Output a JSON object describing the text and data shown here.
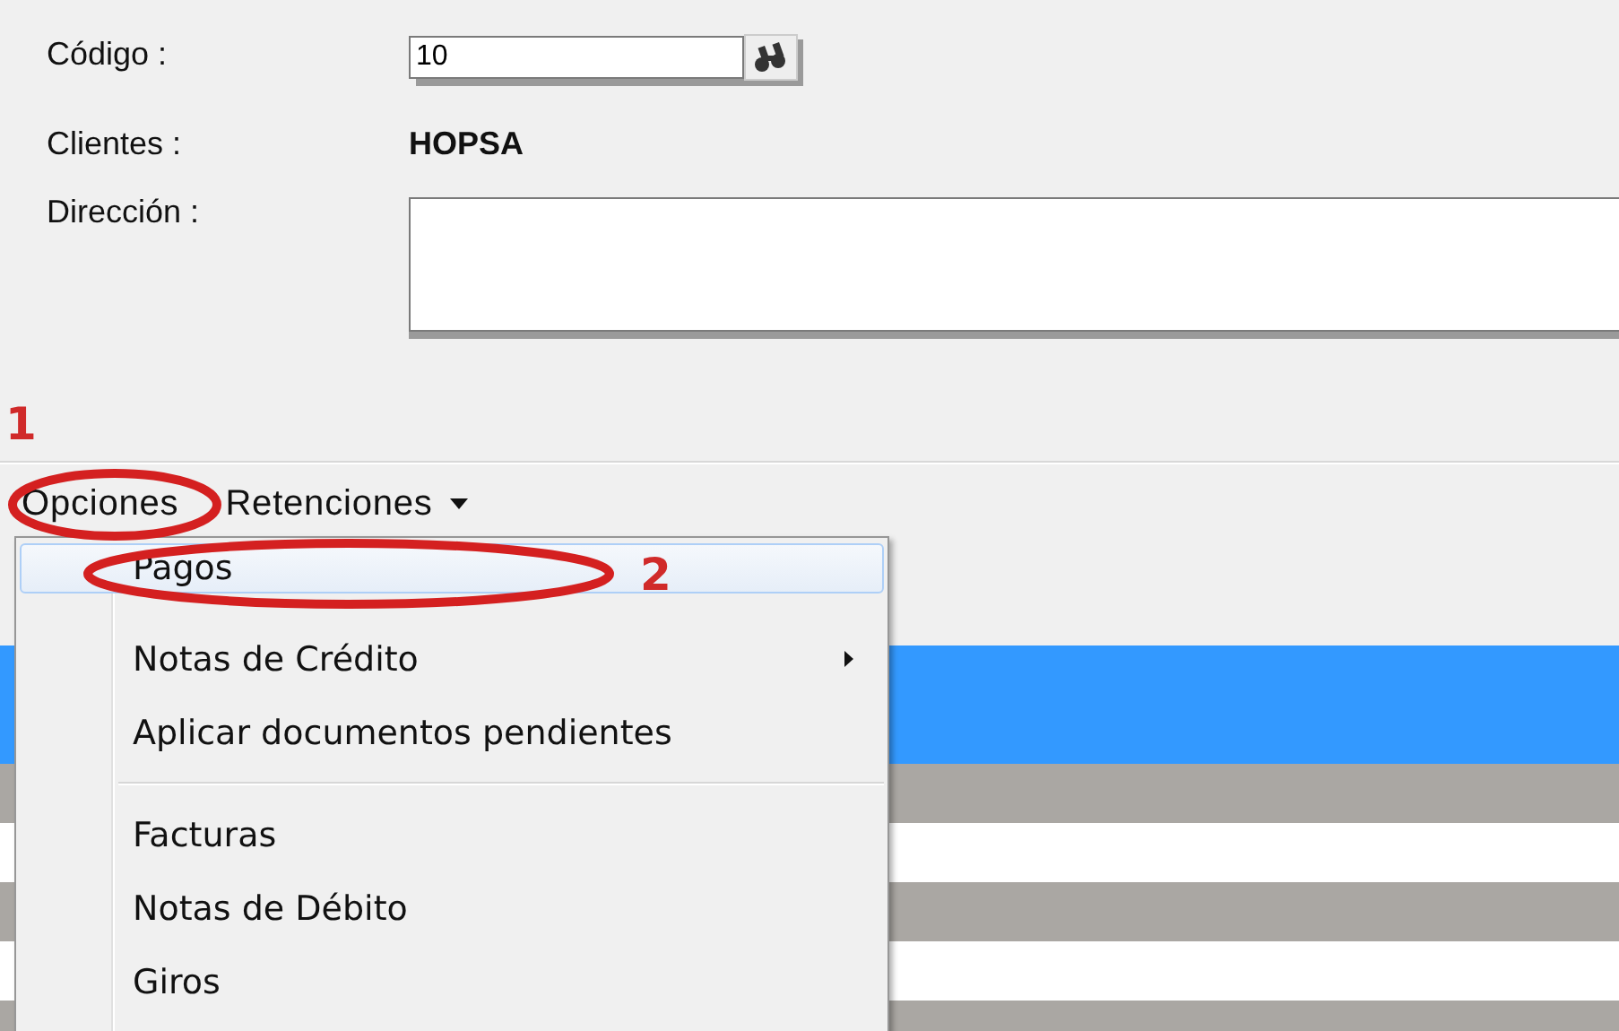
{
  "form": {
    "fields": [
      {
        "kind": "input",
        "label": "Código :",
        "value": "10"
      },
      {
        "kind": "text",
        "label": "Clientes :",
        "value": "HOPSA"
      },
      {
        "kind": "textarea",
        "label": "Dirección :"
      }
    ]
  },
  "toolbar": {
    "items": [
      {
        "label": "Opciones",
        "dropdown": false
      },
      {
        "label": "Retenciones",
        "dropdown": true
      }
    ]
  },
  "menu": {
    "items": [
      {
        "kind": "item",
        "label": "Pagos",
        "selected": true,
        "submenu": false
      },
      {
        "kind": "item",
        "label": "Notas de Crédito",
        "selected": false,
        "submenu": true
      },
      {
        "kind": "item",
        "label": "Aplicar documentos pendientes",
        "selected": false,
        "submenu": false
      },
      {
        "kind": "separator"
      },
      {
        "kind": "item",
        "label": "Facturas",
        "selected": false,
        "submenu": false
      },
      {
        "kind": "item",
        "label": "Notas de Débito",
        "selected": false,
        "submenu": false
      },
      {
        "kind": "item",
        "label": "Giros",
        "selected": false,
        "submenu": false
      }
    ]
  },
  "grid": {
    "rows": [
      {
        "selected": true
      },
      {
        "selected": true
      },
      {
        "selected": false
      },
      {
        "selected": false
      },
      {
        "selected": false
      },
      {
        "selected": false
      },
      {
        "selected": false
      }
    ]
  },
  "annotations": [
    {
      "label": "1"
    },
    {
      "label": "2"
    }
  ]
}
